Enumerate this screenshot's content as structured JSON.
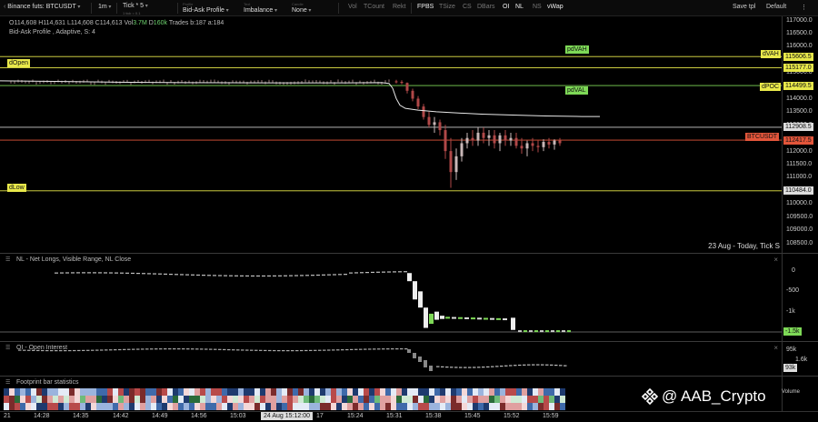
{
  "toolbar": {
    "symbol": "Binance futs: BTCUSDT",
    "timeframe": "1m",
    "tick_label": "Tick * 5",
    "tick_sub": "1 tick = 0.1",
    "profile_caption": "Profile",
    "profile": "Bid-Ask Profile",
    "text_caption": "Text",
    "text": "Imbalance",
    "candle_caption": "Candle",
    "candle": "None",
    "indicators": [
      "Vol",
      "TCount",
      "Rekt",
      "FPBS",
      "TSize",
      "CS",
      "DBars",
      "OI",
      "NL",
      "NS",
      "vWap"
    ],
    "active_indicators": [
      "FPBS",
      "OI",
      "NL",
      "vWap"
    ],
    "save_tpl": "Save tpl",
    "template": "Default",
    "colors": {
      "bg": "#0b0b0b",
      "text": "#dddddd",
      "muted": "#777777"
    }
  },
  "main": {
    "ohlc": {
      "o_label": "O",
      "o": "114,608",
      "h_label": "H",
      "h": "114,631",
      "l_label": "L",
      "l": "114,608",
      "c_label": "C",
      "c": "114,613",
      "vol_label": "Vol",
      "vol": "3.7M",
      "delta_label": "D",
      "delta": "160k",
      "trades": "Trades b:187 a:184"
    },
    "profile_line": "Bid-Ask Profile , Adaptive, S: 4",
    "levels": {
      "dOpen": "dOpen",
      "dLow": "dLow",
      "pdVAH": "pdVAH",
      "pdVAL": "pdVAL",
      "dVAH": "dVAH",
      "dPOC": "dPOC",
      "ticker": "BTCUSDT"
    },
    "date_note": "23 Aug  - Today, Tick S",
    "candles": [
      [
        436,
        114660,
        114720,
        114580,
        114640
      ],
      [
        437,
        114640,
        114700,
        114550,
        114600
      ],
      [
        438,
        114600,
        114620,
        114200,
        114300
      ],
      [
        439,
        114300,
        114380,
        113900,
        114000
      ],
      [
        440,
        114000,
        114100,
        113600,
        113700
      ],
      [
        441,
        113700,
        113800,
        113200,
        113300
      ],
      [
        442,
        113300,
        113500,
        112900,
        113000
      ],
      [
        443,
        113000,
        113300,
        112700,
        113100
      ],
      [
        444,
        113100,
        113200,
        112600,
        112800
      ],
      [
        445,
        112800,
        113000,
        111700,
        112000
      ],
      [
        446,
        112000,
        112500,
        110600,
        111200
      ],
      [
        447,
        111200,
        112100,
        110900,
        111800
      ],
      [
        448,
        111800,
        112500,
        111600,
        112300
      ],
      [
        449,
        112300,
        112700,
        112100,
        112500
      ],
      [
        450,
        112500,
        112800,
        112200,
        112400
      ],
      [
        451,
        112400,
        112900,
        112200,
        112700
      ],
      [
        452,
        112700,
        112900,
        112300,
        112500
      ],
      [
        453,
        112500,
        112800,
        112200,
        112600
      ],
      [
        454,
        112600,
        112800,
        112100,
        112300
      ],
      [
        455,
        112300,
        112700,
        112000,
        112600
      ],
      [
        456,
        112600,
        112800,
        112200,
        112400
      ],
      [
        457,
        112400,
        112700,
        112200,
        112500
      ],
      [
        458,
        112500,
        112700,
        112100,
        112200
      ],
      [
        459,
        112200,
        112500,
        111900,
        112100
      ],
      [
        460,
        112100,
        112400,
        111800,
        112300
      ],
      [
        461,
        112300,
        112500,
        112000,
        112200
      ],
      [
        462,
        112200,
        112400,
        111950,
        112150
      ],
      [
        463,
        112150,
        112450,
        112000,
        112350
      ],
      [
        464,
        112350,
        112500,
        112100,
        112250
      ],
      [
        465,
        112250,
        112450,
        112050,
        112400
      ],
      [
        466,
        112400,
        112500,
        112200,
        112300
      ]
    ],
    "vwap": [
      [
        0,
        114680
      ],
      [
        60,
        114660
      ],
      [
        120,
        114630
      ],
      [
        200,
        114610
      ],
      [
        300,
        114600
      ],
      [
        380,
        114600
      ],
      [
        420,
        114610
      ],
      [
        428,
        114580
      ],
      [
        432,
        114400
      ],
      [
        436,
        114000
      ],
      [
        440,
        113750
      ],
      [
        446,
        113630
      ],
      [
        460,
        113560
      ],
      [
        480,
        113500
      ],
      [
        500,
        113460
      ],
      [
        530,
        113410
      ],
      [
        560,
        113380
      ],
      [
        600,
        113340
      ],
      [
        640,
        113320
      ],
      [
        660,
        113320
      ]
    ],
    "hlines": [
      {
        "price": 115606.5,
        "color": "#e8e84a"
      },
      {
        "price": 115177.0,
        "color": "#e8e84a"
      },
      {
        "price": 114499.5,
        "color": "#7ed957"
      },
      {
        "price": 112908.5,
        "color": "#cccccc"
      },
      {
        "price": 112417.5,
        "color": "#e2553a"
      },
      {
        "price": 110484.0,
        "color": "#e8e84a"
      }
    ]
  },
  "price_axis": {
    "ticks": [
      "117000.0",
      "116500.0",
      "116000.0",
      "115500.0",
      "115000.0",
      "114000.0",
      "113500.0",
      "113000.0",
      "112000.0",
      "111500.0",
      "111000.0",
      "110000.0",
      "109500.0",
      "109000.0",
      "108500.0"
    ],
    "tick_values": [
      117000,
      116500,
      116000,
      115500,
      115000,
      114000,
      113500,
      113000,
      112000,
      111500,
      111000,
      110000,
      109500,
      109000,
      108500
    ],
    "badges": [
      {
        "text": "115606.5",
        "price": 115606.5,
        "color": "#e8e84a"
      },
      {
        "text": "115177.0",
        "price": 115177.0,
        "color": "#e8e84a"
      },
      {
        "text": "114499.5",
        "price": 114499.5,
        "color": "#e8e84a"
      },
      {
        "text": "112908.5",
        "price": 112908.5,
        "color": "#dddddd"
      },
      {
        "text": "112417.5",
        "price": 112417.5,
        "color": "#e2553a"
      },
      {
        "text": "110484.0",
        "price": 110484.0,
        "color": "#dddddd"
      }
    ]
  },
  "nl_panel": {
    "title": "NL - Net Longs, Visible Range, NL Close",
    "ticks": [
      "0",
      "-500",
      "-1k"
    ],
    "badge": "-1.5k",
    "badge_color": "#7ed957"
  },
  "oi_panel": {
    "title": "OI - Open Interest",
    "ticks": [
      "95k"
    ],
    "secondary": "1.6k",
    "badge": "93k"
  },
  "fp_panel": {
    "title": "Footprint bar statistics",
    "volume_label": "Volume"
  },
  "time_axis": {
    "ticks": [
      "21",
      "14:28",
      "14:35",
      "14:42",
      "14:49",
      "14:56",
      "15:03",
      "17",
      "15:24",
      "15:31",
      "15:38",
      "15:45",
      "15:52",
      "15:59"
    ],
    "crosshair": "24 Aug 15:12:00"
  },
  "watermark": {
    "text": "@ AAB_Crypto"
  }
}
